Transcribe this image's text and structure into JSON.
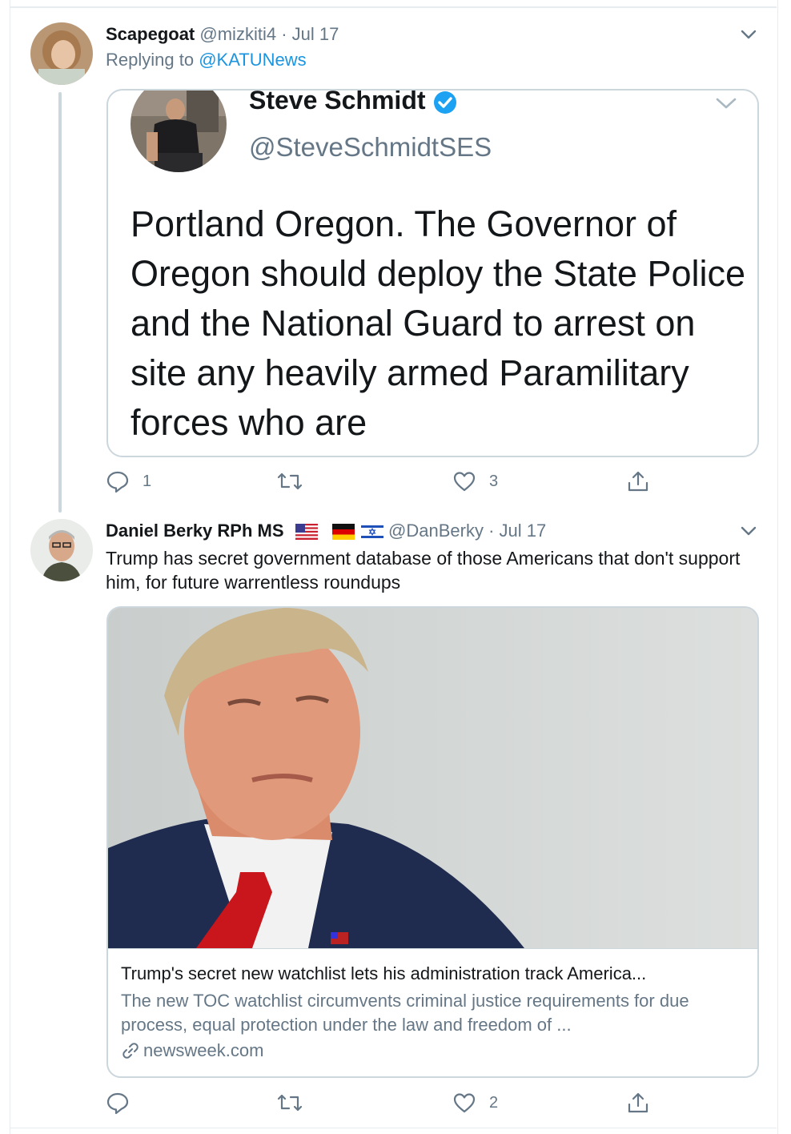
{
  "tweet1": {
    "name": "Scapegoat",
    "handle": "@mizkiti4",
    "separator": "·",
    "date": "Jul 17",
    "replying_prefix": "Replying to",
    "replying_to": "@KATUNews",
    "quote": {
      "name": "Steve Schmidt",
      "handle": "@SteveSchmidtSES",
      "text": "Portland Oregon.  The Governor of Oregon should deploy the State Police and the National Guard to arrest on site any heavily armed Paramilitary forces who are"
    },
    "actions": {
      "reply_count": "1",
      "retweet_count": "",
      "like_count": "3"
    }
  },
  "tweet2": {
    "name": "Daniel Berky RPh MS",
    "flags": [
      "us-flag",
      "germany-flag",
      "israel-flag"
    ],
    "handle": "@DanBerky",
    "separator": "·",
    "date": "Jul 17",
    "text": "Trump has secret government database of those Americans that don't support him, for future warrentless roundups",
    "card": {
      "title": "Trump's secret new watchlist lets his administration track America...",
      "description": "The new TOC watchlist circumvents criminal justice requirements for due process, equal protection under the law and freedom of ...",
      "domain": "newsweek.com"
    },
    "actions": {
      "reply_count": "",
      "retweet_count": "",
      "like_count": "2"
    }
  },
  "colors": {
    "link": "#1b95e0",
    "secondary": "#657786",
    "border": "#ccd6dd",
    "verified": "#1da1f2"
  }
}
